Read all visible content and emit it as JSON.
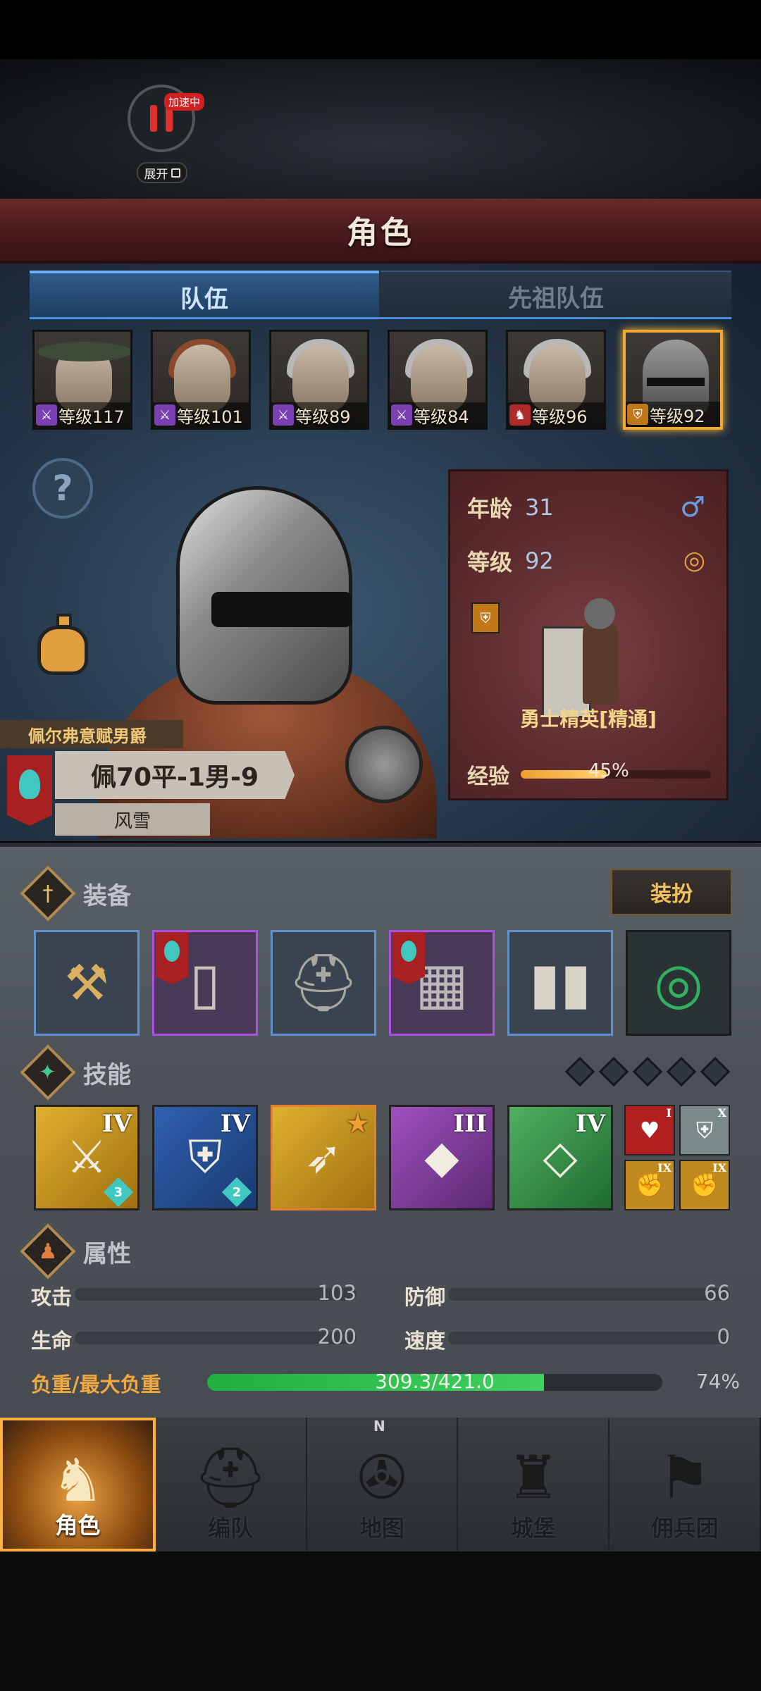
{
  "top": {
    "speed_badge": "加速中",
    "expand_label": "展开"
  },
  "title": "角色",
  "tabs": {
    "team": "队伍",
    "ancestor": "先祖队伍"
  },
  "roster": [
    {
      "level": "等级117",
      "class_icon": "staff-icon",
      "class_color": "#7a3fb0"
    },
    {
      "level": "等级101",
      "class_icon": "staff-icon",
      "class_color": "#7a3fb0"
    },
    {
      "level": "等级89",
      "class_icon": "staff-icon",
      "class_color": "#7a3fb0"
    },
    {
      "level": "等级84",
      "class_icon": "staff-icon",
      "class_color": "#7a3fb0"
    },
    {
      "level": "等级96",
      "class_icon": "horse-icon",
      "class_color": "#b02a2a"
    },
    {
      "level": "等级92",
      "class_icon": "shield-icon",
      "class_color": "#c07818",
      "selected": true
    }
  ],
  "character": {
    "title": "佩尔弗意赋男爵",
    "name": "佩70平-1男-9",
    "sub": "风雪",
    "age_label": "年龄",
    "age": "31",
    "level_label": "等级",
    "level": "92",
    "class_name": "勇士精英[精通]",
    "exp_label": "经验",
    "exp_pct": "45%",
    "exp_fraction": 0.45,
    "gender_icon": "male-icon",
    "ring_icon": "ring-icon"
  },
  "equipment": {
    "label": "装备",
    "dress_button": "装扮",
    "slots": [
      {
        "name": "hammer-icon",
        "rarity": "blue"
      },
      {
        "name": "shield-icon",
        "rarity": "purple",
        "flag": true
      },
      {
        "name": "helmet-icon",
        "rarity": "blue"
      },
      {
        "name": "chainmail-icon",
        "rarity": "purple",
        "flag": true
      },
      {
        "name": "boots-icon",
        "rarity": "blue"
      },
      {
        "name": "ring-icon",
        "rarity": "dark"
      }
    ]
  },
  "skills": {
    "label": "技能",
    "items": [
      {
        "rank": "IV",
        "num": "3",
        "color": "gold",
        "icon": "shield-sword-icon"
      },
      {
        "rank": "IV",
        "num": "2",
        "color": "blue",
        "icon": "shield-bash-icon"
      },
      {
        "rank": "★",
        "num": "",
        "color": "gold",
        "icon": "charge-icon"
      },
      {
        "rank": "III",
        "num": "",
        "color": "purple",
        "icon": "crystal-icon"
      },
      {
        "rank": "IV",
        "num": "",
        "color": "green",
        "icon": "crystal-icon"
      }
    ],
    "mini": [
      {
        "rank": "I",
        "icon": "heart-icon"
      },
      {
        "rank": "X",
        "icon": "shield-icon"
      },
      {
        "rank": "IX",
        "icon": "bash-icon"
      },
      {
        "rank": "IX",
        "icon": "bash-icon"
      }
    ]
  },
  "attributes": {
    "label": "属性",
    "attack_label": "攻击",
    "attack": "103",
    "defense_label": "防御",
    "defense": "66",
    "hp_label": "生命",
    "hp": "200",
    "speed_label": "速度",
    "speed": "0",
    "load_label": "负重/最大负重",
    "load_value": "309.3/421.0",
    "load_pct": "74%",
    "load_fraction": 0.74
  },
  "nav": {
    "compass_n": "N",
    "items": [
      {
        "label": "角色",
        "icon": "knight-icon",
        "active": true
      },
      {
        "label": "编队",
        "icon": "helmet-icon"
      },
      {
        "label": "地图",
        "icon": "compass-icon"
      },
      {
        "label": "城堡",
        "icon": "castle-icon"
      },
      {
        "label": "佣兵团",
        "icon": "mercenary-icon"
      }
    ]
  }
}
